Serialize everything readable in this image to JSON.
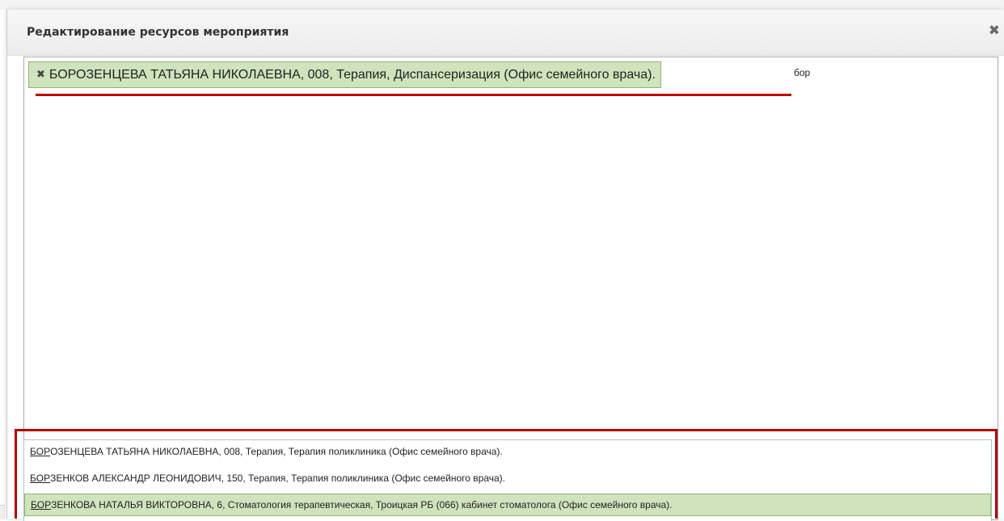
{
  "dialog": {
    "title": "Редактирование ресурсов мероприятия",
    "close_icon": "close-icon"
  },
  "editor": {
    "selected_token": {
      "remove_icon": "remove-icon",
      "remove_glyph": "✖",
      "label": "БОРОЗЕНЦЕВА ТАТЬЯНА НИКОЛАЕВНА, 008, Терапия, Диспансеризация (Офис семейного врача)."
    },
    "search_text": "бор"
  },
  "dropdown": {
    "items": [
      {
        "match": "БОР",
        "rest": "ОЗЕНЦЕВА ТАТЬЯНА НИКОЛАЕВНА, 008, Терапия, Терапия поликлиника (Офис семейного врача).",
        "selected": false
      },
      {
        "match": "БОР",
        "rest": "ЗЕНКОВ АЛЕКСАНДР ЛЕОНИДОВИЧ, 150, Терапия, Терапия поликлиника (Офис семейного врача).",
        "selected": false
      },
      {
        "match": "БОР",
        "rest": "ЗЕНКОВА НАТАЛЬЯ ВИКТОРОВНА, 6, Стоматология терапевтическая, Троицкая РБ (066) кабинет стоматолога (Офис семейного врача).",
        "selected": true
      }
    ]
  },
  "colors": {
    "token_bg": "#cfe3bd",
    "highlight_border": "#b40000"
  }
}
